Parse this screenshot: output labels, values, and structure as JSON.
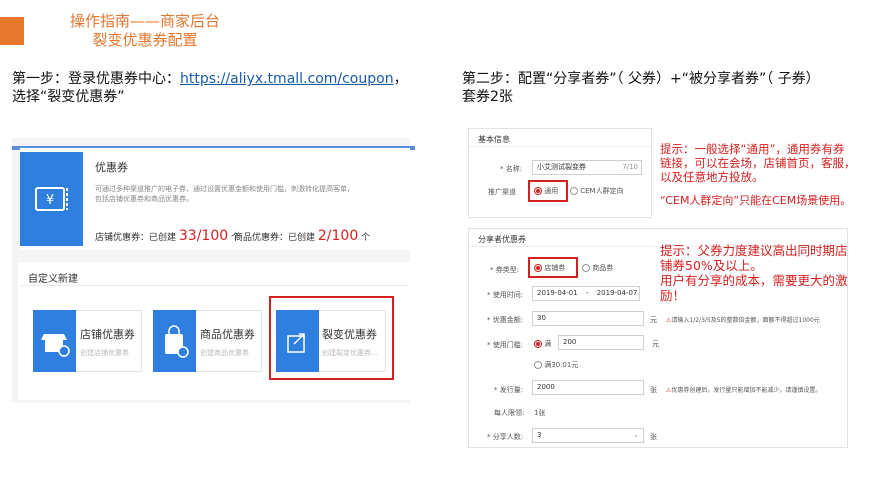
{
  "header": {
    "title_line1": "操作指南——商家后台",
    "title_line2": "裂变优惠券配置"
  },
  "step1": {
    "prefix": "第一步：登录优惠券中心：",
    "link": "https://aliyx.tmall.com/coupon",
    "suffix": "，",
    "line2": "选择“裂变优惠券”"
  },
  "step2": {
    "line1": "第二步：配置“分享者券”（ 父券）+“被分享者券”（ 子券）",
    "line2": "套券2张"
  },
  "left_panel": {
    "coupon_title": "优惠券",
    "coupon_desc": "可通过多种渠道推广的电子券，通过设置优惠金额和使用门槛，刺激转化提高客单，包括店铺优惠券和商品优惠券。",
    "shop_created_label": "店铺优惠券：已创建",
    "shop_created_count": "33/100",
    "shop_created_unit": "个",
    "item_created_label": "商品优惠券：已创建",
    "item_created_count": "2/100",
    "item_created_unit": "个",
    "custom_title": "自定义新建",
    "tiles": [
      {
        "title": "店铺优惠券",
        "desc": "创建店铺优惠券"
      },
      {
        "title": "商品优惠券",
        "desc": "创建商品优惠券"
      },
      {
        "title": "裂变优惠券",
        "desc": "创建裂变优惠券..."
      }
    ]
  },
  "form1": {
    "section": "基本信息",
    "name_label": "* 名称:",
    "name_value": "小艾测试裂变券",
    "name_count": "7/10",
    "channel_label": "推广渠道",
    "channel_opt1": "通用",
    "channel_opt2": "CEM人群定向"
  },
  "tip1": {
    "line1": "提示：一般选择“通用”，通用券有券",
    "line2": "链接，可以在会场，店铺首页，客服，",
    "line3": "以及任意地方投放。",
    "line4": "“CEM人群定向”只能在CEM场景使用。"
  },
  "form2": {
    "section": "分享者优惠券",
    "type_label": "* 券类型:",
    "type_opt1": "店铺券",
    "type_opt2": "商品券",
    "time_label": "* 使用时间:",
    "time_start": "2019-04-01",
    "time_sep": "-",
    "time_end": "2019-04-07",
    "amount_label": "* 优惠金额:",
    "amount_value": "30",
    "amount_unit": "元",
    "amount_note": "请输入1/2/3/5及5的整数倍金额，面额不得超过1000元",
    "threshold_label": "* 使用门槛:",
    "threshold_opt1": "满",
    "threshold_value": "200",
    "threshold_unit": "元",
    "threshold_opt2": "满30.01元",
    "issue_label": "* 发行量:",
    "issue_value": "2000",
    "issue_unit": "张",
    "issue_note": "优惠券创建后，发行量只能增加不能减少，请谨慎设置。",
    "limit_label": "每人限领:",
    "limit_value": "1张",
    "share_label": "* 分享人数:",
    "share_value": "3",
    "share_unit": "张"
  },
  "tip2": {
    "line1": "提示：父券力度建议高出同时期店",
    "line2": "铺券50%及以上。",
    "line3": "用户有分享的成本，需要更大的激",
    "line4": "励！"
  }
}
